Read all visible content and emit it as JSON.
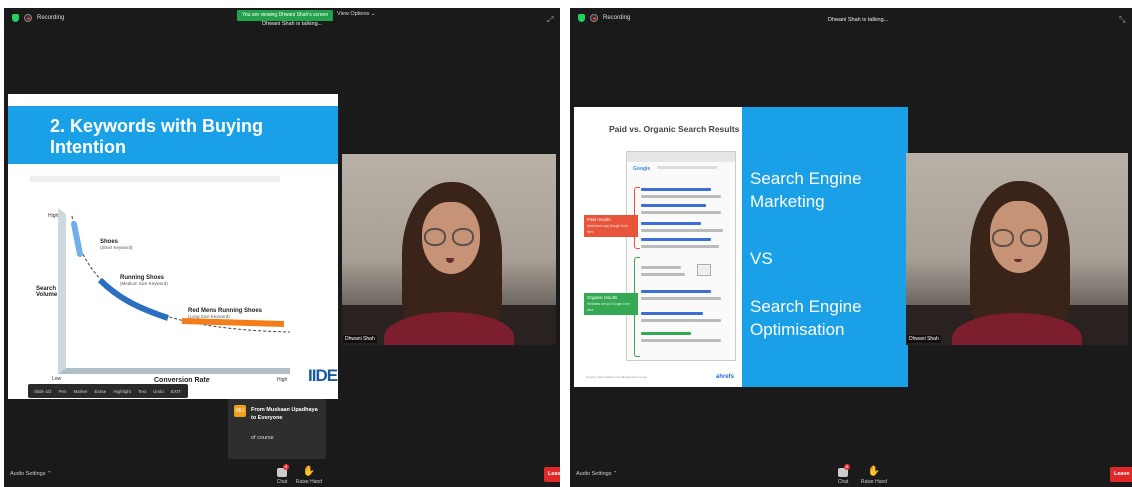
{
  "left": {
    "recording": "Recording",
    "viewing_banner": "You are viewing Dhwani Shah's screen",
    "talking": "Dhwani Shah is talking...",
    "view_options": "View Options",
    "slide": {
      "title": "2. Keywords with Buying Intention",
      "y_high": "High",
      "y_low": "Low",
      "y_axis": "Search Volume",
      "x_axis": "Conversion Rate",
      "x_high": "High",
      "k1": "Shoes",
      "k1_sub": "(Short Keyword)",
      "k2": "Running Shoes",
      "k2_sub": "(Medium Size Keyword)",
      "k3": "Red Mens Running Shoes",
      "k3_sub": "(Long Size Keyword)",
      "logo": "IIDE"
    },
    "control_bar": [
      "Slide 4/2",
      "Pen",
      "Marker",
      "Erase",
      "Highlight",
      "Text",
      "Undo",
      "EXIT"
    ],
    "chat": {
      "avatar": "MU",
      "from": "From Muskaan Upadhaya to Everyone",
      "message": "of course"
    },
    "audio_settings": "Audio Settings",
    "chat_label": "Chat",
    "chat_badge": "8",
    "raise_hand": "Raise Hand",
    "leave": "Leave",
    "video_name": "Dhwani Shah"
  },
  "right": {
    "recording": "Recording",
    "talking": "Dhwani Shah is talking...",
    "slide": {
      "title": "Paid vs. Organic Search Results",
      "paid": "Paid results",
      "paid_sub": "Advertisers pay Google to be here",
      "organic": "Organic results",
      "organic_sub": "Websites are put Google to be here",
      "source": "Source: https://ahrefs.com/blog/search-vs-seo",
      "logo": "ahrefs",
      "line1": "Search Engine",
      "line2": "Marketing",
      "line3": "VS",
      "line4": "Search Engine",
      "line5": "Optimisation"
    },
    "audio_settings": "Audio Settings",
    "chat_label": "Chat",
    "chat_badge": "8",
    "raise_hand": "Raise Hand",
    "leave": "Leave",
    "video_name": "Dhwani Shah"
  }
}
